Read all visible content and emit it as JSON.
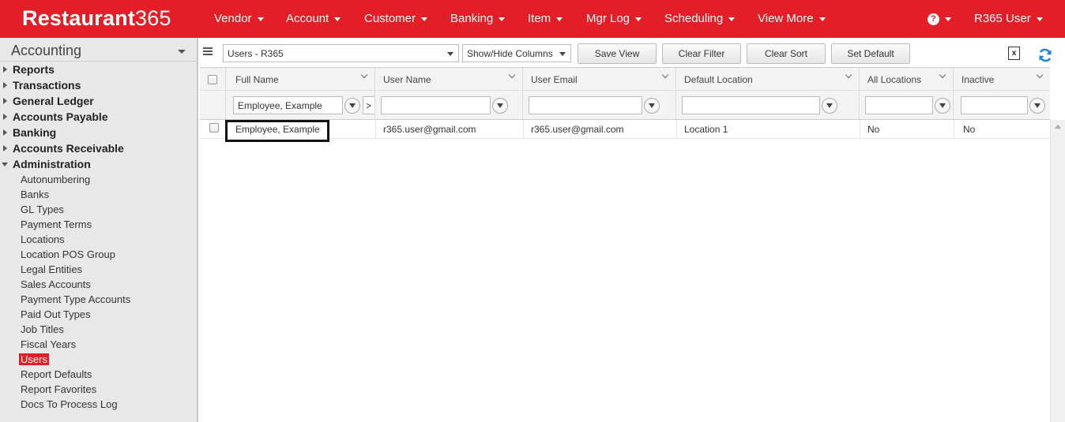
{
  "brand": {
    "name_bold": "Restaurant",
    "name_num": "365"
  },
  "nav": {
    "items": [
      "Vendor",
      "Account",
      "Customer",
      "Banking",
      "Item",
      "Mgr Log",
      "Scheduling",
      "View More"
    ],
    "help": "?",
    "user": "R365 User"
  },
  "sidebar": {
    "title": "Accounting",
    "sections": [
      "Reports",
      "Transactions",
      "General Ledger",
      "Accounts Payable",
      "Banking",
      "Accounts Receivable",
      "Administration"
    ],
    "admin_items": [
      "Autonumbering",
      "Banks",
      "GL Types",
      "Payment Terms",
      "Locations",
      "Location POS Group",
      "Legal Entities",
      "Sales Accounts",
      "Payment Type Accounts",
      "Paid Out Types",
      "Job Titles",
      "Fiscal Years",
      "Users",
      "Report Defaults",
      "Report Favorites",
      "Docs To Process Log"
    ],
    "active_item": "Users"
  },
  "toolbar": {
    "view_select": "Users - R365",
    "show_hide": "Show/Hide Columns",
    "save_view": "Save View",
    "clear_filter": "Clear Filter",
    "clear_sort": "Clear Sort",
    "set_default": "Set Default",
    "excel_glyph": "x"
  },
  "grid": {
    "columns": [
      "Full Name",
      "User Name",
      "User Email",
      "Default Location",
      "All Locations",
      "Inactive"
    ],
    "filters": {
      "full_name": "Employee, Example",
      "full_name_clear": ">"
    },
    "rows": [
      {
        "full_name": "Employee, Example",
        "user_name": "r365.user@gmail.com",
        "user_email": "r365.user@gmail.com",
        "default_location": "Location 1",
        "all_locations": "No",
        "inactive": "No"
      }
    ]
  },
  "colors": {
    "brand_red": "#e41e26",
    "refresh_blue": "#1e88d6"
  }
}
